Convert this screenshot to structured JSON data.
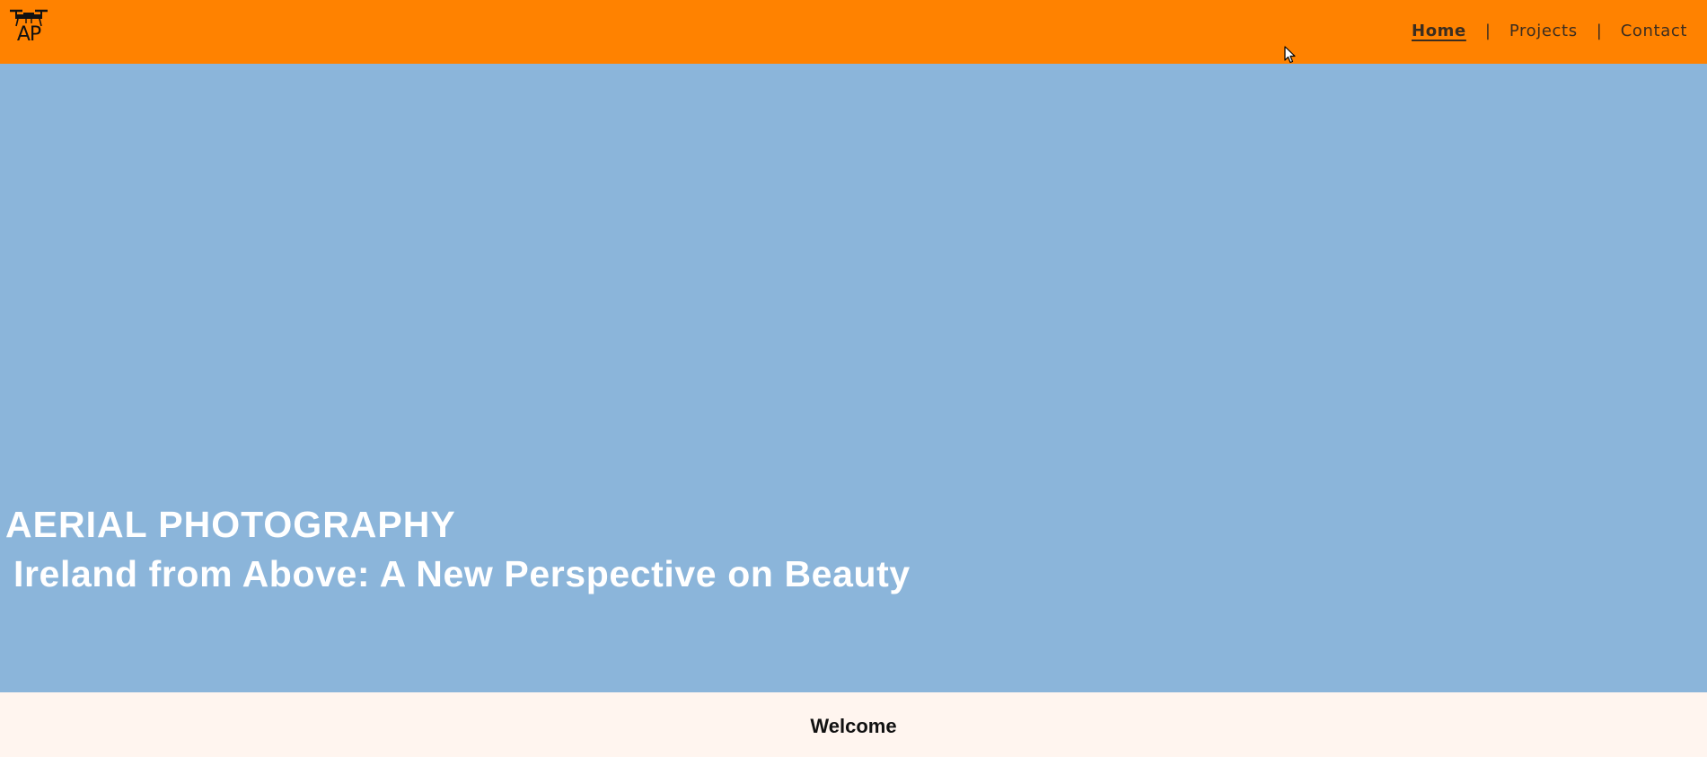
{
  "header": {
    "logo": {
      "icon": "drone-icon",
      "text": "AP"
    },
    "nav": {
      "items": [
        {
          "label": "Home",
          "active": true
        },
        {
          "label": "Projects",
          "active": false
        },
        {
          "label": "Contact",
          "active": false
        }
      ],
      "separator": "|"
    }
  },
  "hero": {
    "title": "AERIAL PHOTOGRAPHY",
    "subtitle": "Ireland from Above: A New Perspective on Beauty"
  },
  "welcome": {
    "heading": "Welcome"
  },
  "colors": {
    "header_bg": "#ff8200",
    "hero_bg": "#8bb5da",
    "welcome_bg": "#fff5ef",
    "hero_text": "#ffffff"
  }
}
